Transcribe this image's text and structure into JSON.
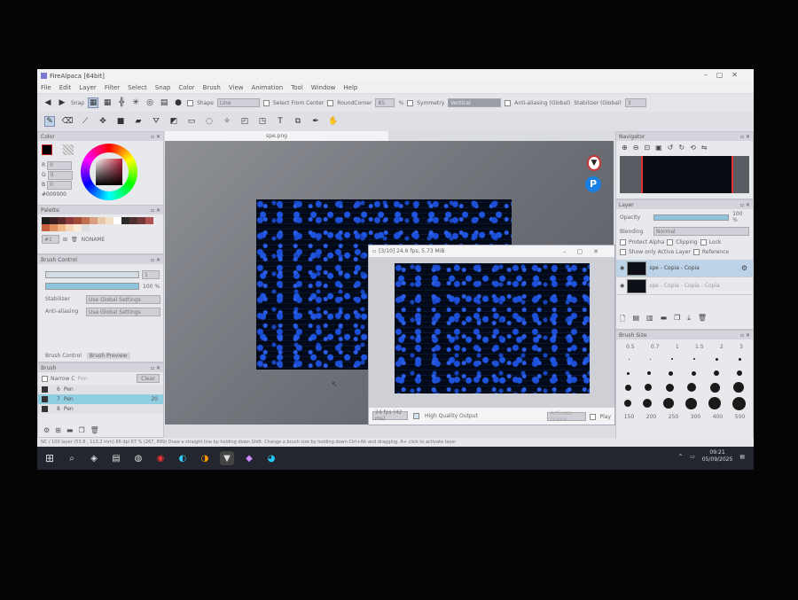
{
  "window": {
    "title": "FireAlpaca [64bit]"
  },
  "menu": [
    "File",
    "Edit",
    "Layer",
    "Filter",
    "Select",
    "Snap",
    "Color",
    "Brush",
    "View",
    "Animation",
    "Tool",
    "Window",
    "Help"
  ],
  "toolbar1": {
    "snap_label": "Snap",
    "shape_label": "Shape",
    "shape_value": "Line",
    "select_from_center": "Select From Center",
    "round_corner": "RoundCorner",
    "round_value": "85",
    "percent": "%",
    "symmetry": "Symmetry",
    "symmetry_value": "Vertical",
    "antialias_global": "Anti-aliasing (Global)",
    "stabilizer_global": "Stabilizer (Global)",
    "stabilizer_value": "3"
  },
  "document": {
    "tab": "spe.png"
  },
  "color_panel": {
    "title": "Color",
    "r_label": "R",
    "r_value": "0",
    "g_label": "G",
    "g_value": "0",
    "b_label": "B",
    "b_value": "0",
    "hex": "#000000"
  },
  "palette": {
    "title": "Palette",
    "index": "#1",
    "name": "NONAME"
  },
  "brush_control": {
    "title": "Brush Control",
    "size_value": "1",
    "opacity_value": "100 %",
    "stabilizer_label": "Stabilizer",
    "stabilizer_value": "Use Global Settings",
    "antialias_label": "Anti-aliasing",
    "antialias_value": "Use Global Settings",
    "tab1": "Brush Control",
    "tab2": "Brush Preview"
  },
  "brush_panel": {
    "title": "Brush",
    "narrow_label": "Narrow C",
    "narrow_value": "Pen",
    "clear_btn": "Clear",
    "items": [
      {
        "num": "6",
        "name": "Pen"
      },
      {
        "num": "7",
        "name": "Pen",
        "size": "20"
      },
      {
        "num": "8",
        "name": "Pen"
      }
    ]
  },
  "preview": {
    "title": "[3/10] 24.6 fps, 5.73 MiB",
    "fps_value": "24 fps (42 ms)",
    "hq_label": "High Quality Output",
    "activate_btn": "Activate Frame",
    "play_label": "Play"
  },
  "navigator": {
    "title": "Navigator"
  },
  "layer_panel": {
    "title": "Layer",
    "opacity_label": "Opacity",
    "opacity_value": "100 %",
    "blending_label": "Blending",
    "blending_value": "Normal",
    "protect_alpha": "Protect Alpha",
    "clipping": "Clipping",
    "lock": "Lock",
    "show_only_active": "Show only Active Layer",
    "reference": "Reference",
    "layers": [
      {
        "name": "spe - Copia - Copia"
      },
      {
        "name": "spe - Copia - Copia - Copia"
      }
    ]
  },
  "brush_size": {
    "title": "Brush Size",
    "row1": [
      "0.5",
      "0.7",
      "1",
      "1.5",
      "2",
      "3"
    ],
    "sizes": [
      [
        1,
        1,
        2,
        2,
        3,
        3
      ],
      [
        3,
        4,
        5,
        5,
        6,
        6
      ],
      [
        7,
        8,
        9,
        10,
        11,
        12
      ],
      [
        8,
        10,
        12,
        13,
        14,
        15
      ]
    ],
    "row_last": [
      "150",
      "200",
      "250",
      "300",
      "400",
      "500"
    ]
  },
  "status": {
    "text": "NC / 100 layer   (53.8 , 113.2 mm)   86 dpi   67 %   (267, 899)   Draw a straight line by holding down Shift. Change a brush size by holding down Ctrl+Alt and dragging. A+ click to activate layer"
  },
  "taskbar": {
    "time": "09:21",
    "date": "05/09/2025"
  },
  "colors": {
    "accent": "#2a6ef0",
    "selection": "#bcd3e8",
    "taskbar": "#23262e"
  }
}
